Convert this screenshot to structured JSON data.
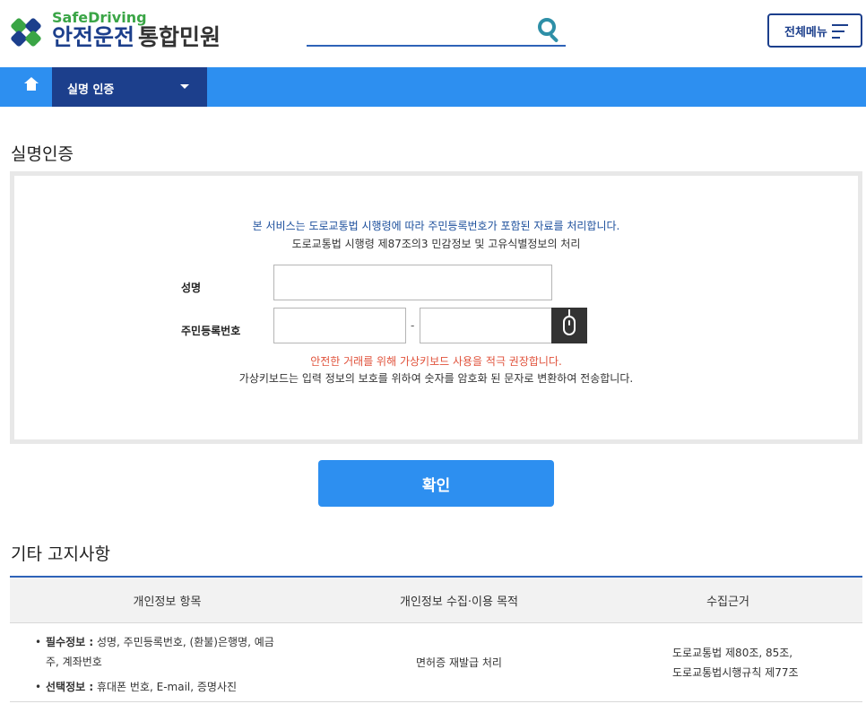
{
  "header": {
    "logo_sub": "SafeDriving",
    "logo_main": "안전운전",
    "logo_tail": "통합민원",
    "menu_label": "전체메뉴"
  },
  "nav": {
    "current": "실명 인증"
  },
  "auth": {
    "title": "실명인증",
    "notice_line1": "본 서비스는 도로교통법 시행령에 따라 주민등록번호가 포함된 자료를 처리합니다.",
    "notice_line2": "도로교통법 시행령 제87조의3 민감정보 및 고유식별정보의 처리",
    "name_label": "성명",
    "rrn_label": "주민등록번호",
    "rrn_dash": "-",
    "name_value": "",
    "rrn_front_value": "",
    "rrn_back_value": "",
    "warn_line1": "안전한 거래를 위해 가상키보드 사용을 적극 권장합니다.",
    "warn_line2": "가상키보드는 입력 정보의 보호를 위하여 숫자를 암호화 된 문자로 변환하여 전송합니다.",
    "confirm_label": "확인"
  },
  "notice": {
    "title": "기타 고지사항",
    "headers": [
      "개인정보 항목",
      "개인정보 수집·이용 목적",
      "수집근거"
    ],
    "row": {
      "required_label": "필수정보 :",
      "required_text": "성명, 주민등록번호, (환불)은행명, 예금",
      "required_text2": "주, 계좌번호",
      "optional_label": "선택정보 :",
      "optional_text": "휴대폰 번호, E-mail, 증명사진",
      "purpose": "면허증 재발급 처리",
      "basis_line1": "도로교통법 제80조, 85조,",
      "basis_line2": "도로교통법시행규칙 제77조"
    }
  },
  "colors": {
    "primary": "#2d8ff0",
    "navy": "#1c3f8c",
    "green": "#3aa546",
    "warn": "#e0523b"
  }
}
